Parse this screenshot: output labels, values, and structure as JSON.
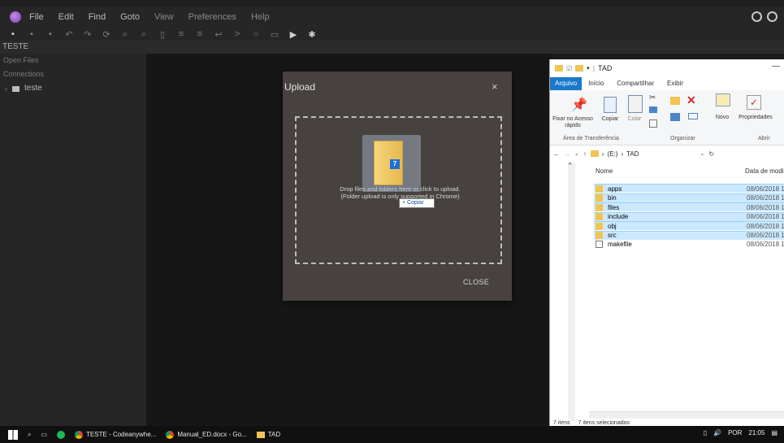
{
  "ide": {
    "menu": [
      "File",
      "Edit",
      "Find",
      "Goto",
      "View",
      "Preferences",
      "Help"
    ],
    "project_name": "TESTE",
    "sidebar": {
      "open_files": "Open Files",
      "connections": "Connections",
      "tree_item": "teste"
    }
  },
  "upload_dialog": {
    "title": "Upload",
    "close_x": "×",
    "drop_line1": "Drop files and folders here or click to upload.",
    "drop_line2": "(Folder upload is only supported in Chrome)",
    "close_button": "CLOSE",
    "drag_badge": "7",
    "copy_tooltip": "+ Copiar"
  },
  "explorer": {
    "title": "TAD",
    "tabs": [
      "Arquivo",
      "Início",
      "Compartilhar",
      "Exibir"
    ],
    "ribbon": {
      "pin_label": "Fixar no Acesso rápido",
      "copy_label": "Copiar",
      "paste_label": "Colar",
      "new_label": "Novo",
      "properties_label": "Propriedades",
      "group_clipboard": "Área de Transferência",
      "group_organize": "Organizar",
      "group_open": "Abrir"
    },
    "address": {
      "drive": "(E:)",
      "folder": "TAD"
    },
    "columns": {
      "name": "Nome",
      "date": "Data de modi"
    },
    "rows": [
      {
        "name": "apps",
        "date": "08/06/2018 1!"
      },
      {
        "name": "bin",
        "date": "08/06/2018 1!"
      },
      {
        "name": "files",
        "date": "08/06/2018 1!"
      },
      {
        "name": "include",
        "date": "08/06/2018 1!"
      },
      {
        "name": "obj",
        "date": "08/06/2018 1!"
      },
      {
        "name": "src",
        "date": "08/06/2018 1!"
      },
      {
        "name": "makefile",
        "date": "08/06/2018 1!"
      }
    ],
    "status": {
      "items": "7 itens",
      "selected": "7 itens selecionados"
    }
  },
  "taskbar": {
    "apps": [
      "TESTE - Codeanywhe...",
      "Manual_ED.docx - Go...",
      "TAD"
    ],
    "tray": {
      "lang": "POR",
      "time": "21:05"
    }
  }
}
